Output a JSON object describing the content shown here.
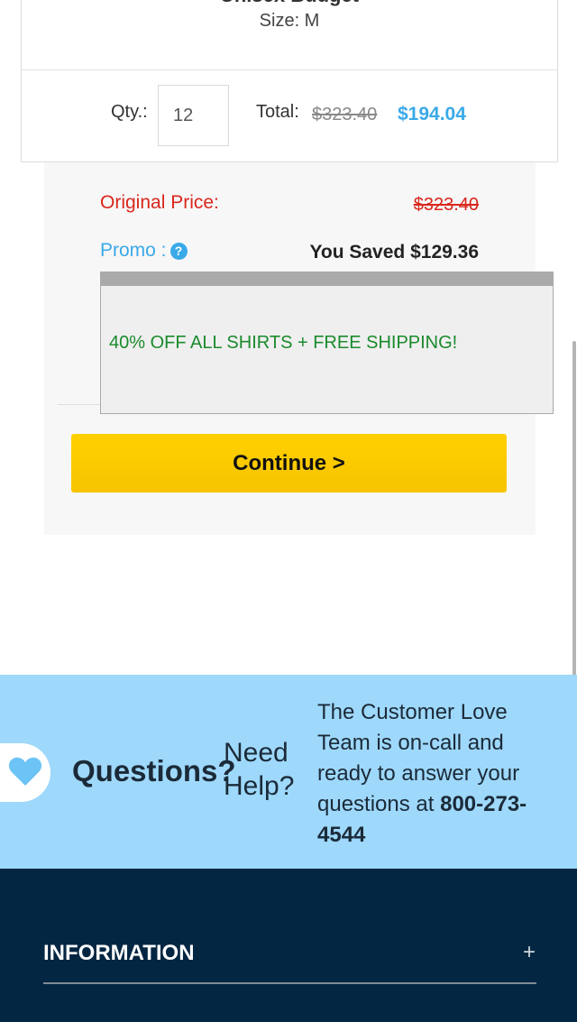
{
  "cart_item": {
    "product_name": "Unisex Budget",
    "size": "Size: M",
    "qty_label": "Qty.:",
    "qty_value": "12",
    "total_label": "Total:",
    "total_original": "$323.40",
    "total_discounted": "$194.04"
  },
  "summary": {
    "original_price_label": "Original Price:",
    "original_price_value": "$323.40",
    "promo_label": "Promo :",
    "promo_icon": "?",
    "saved_text": "You Saved $129.36",
    "promo_message": "40% OFF ALL SHIRTS + FREE SHIPPING!",
    "continue_label": "Continue >"
  },
  "help": {
    "questions": "Questions?",
    "need": "Need",
    "help_word": "Help?",
    "text": "The Customer Love Team is on-call and ready to answer your questions at ",
    "phone": "800-273-4544"
  },
  "footer": {
    "information": "INFORMATION",
    "expand_icon": "+"
  },
  "colors": {
    "accent_blue": "#3aa9e8",
    "red": "#d9261c",
    "green": "#1a8a2c",
    "button_yellow": "#ffcc00",
    "help_band": "#9ed8fb",
    "footer_navy": "#032642"
  }
}
